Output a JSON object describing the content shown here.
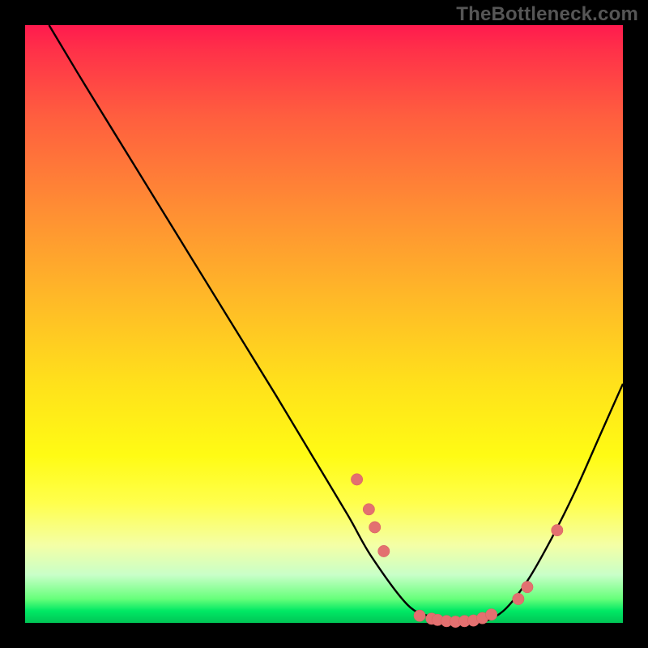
{
  "watermark": "TheBottleneck.com",
  "colors": {
    "bg": "#000000",
    "dot": "#e37070",
    "curve": "#000000"
  },
  "chart_data": {
    "type": "line",
    "title": "",
    "xlabel": "",
    "ylabel": "",
    "xlim": [
      0,
      100
    ],
    "ylim": [
      0,
      100
    ],
    "grid": false,
    "legend": false,
    "series": [
      {
        "name": "curve",
        "x": [
          4,
          10,
          18,
          26,
          34,
          42,
          48,
          54,
          58,
          64,
          68,
          72,
          76,
          80,
          84,
          88,
          92,
          96,
          100
        ],
        "values": [
          100,
          90,
          77,
          64,
          51,
          38,
          28,
          18,
          11,
          3,
          1,
          0,
          0,
          2,
          7,
          14,
          22,
          31,
          40
        ]
      }
    ],
    "markers": [
      {
        "x": 55.5,
        "y": 24
      },
      {
        "x": 57.5,
        "y": 19
      },
      {
        "x": 58.5,
        "y": 16
      },
      {
        "x": 60.0,
        "y": 12
      },
      {
        "x": 66.0,
        "y": 1.2
      },
      {
        "x": 68.0,
        "y": 0.7
      },
      {
        "x": 69.0,
        "y": 0.5
      },
      {
        "x": 70.5,
        "y": 0.3
      },
      {
        "x": 72.0,
        "y": 0.2
      },
      {
        "x": 73.5,
        "y": 0.3
      },
      {
        "x": 75.0,
        "y": 0.4
      },
      {
        "x": 76.5,
        "y": 0.8
      },
      {
        "x": 78.0,
        "y": 1.4
      },
      {
        "x": 82.5,
        "y": 4.0
      },
      {
        "x": 84.0,
        "y": 6.0
      },
      {
        "x": 89.0,
        "y": 15.5
      }
    ]
  }
}
